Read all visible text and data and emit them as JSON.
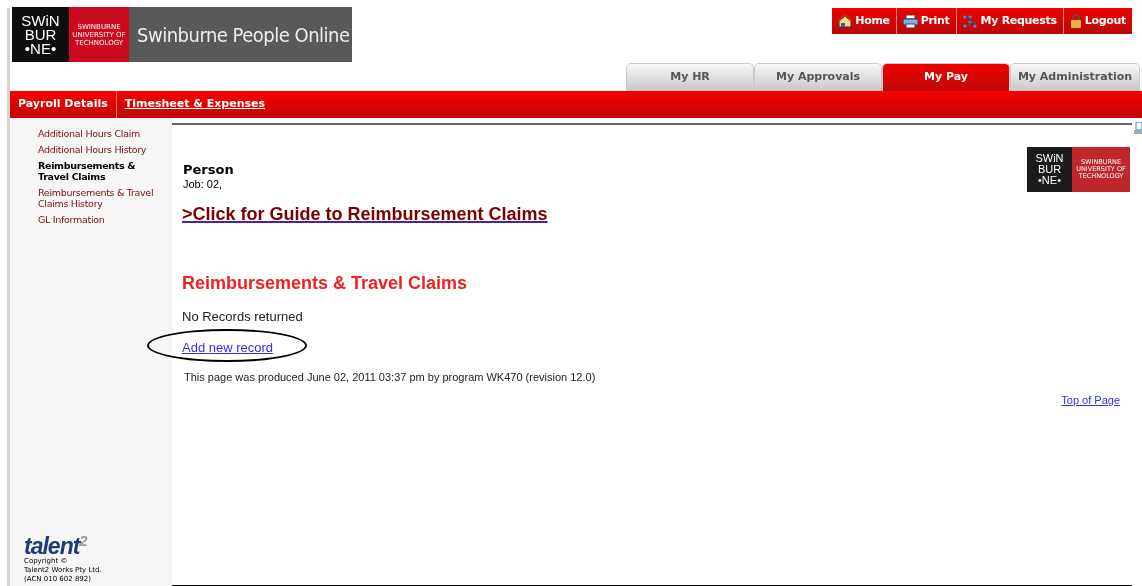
{
  "header": {
    "logo": {
      "lines": [
        "SWiN",
        "BUR",
        "•NE•"
      ],
      "tagline": "SWINBURNE UNIVERSITY OF TECHNOLOGY"
    },
    "title": "Swinburne People Online"
  },
  "top_buttons": [
    {
      "kind": "home",
      "label": "Home"
    },
    {
      "kind": "print",
      "label": "Print"
    },
    {
      "kind": "requests",
      "label": "My Requests"
    },
    {
      "kind": "logout",
      "label": "Logout"
    }
  ],
  "tabs": [
    {
      "label": "My HR",
      "selected": false
    },
    {
      "label": "My Approvals",
      "selected": false
    },
    {
      "label": "My Pay",
      "selected": true
    },
    {
      "label": "My Administration",
      "selected": false
    }
  ],
  "subnav": [
    {
      "label": "Payroll Details",
      "selected": true
    },
    {
      "label": "Timesheet & Expenses",
      "selected": false
    }
  ],
  "sidebar": {
    "items": [
      {
        "label": "Additional Hours Claim",
        "selected": false
      },
      {
        "label": "Additional Hours History",
        "selected": false
      },
      {
        "label": "Reimbursements & Travel Claims",
        "selected": true
      },
      {
        "label": "Reimbursements & Travel Claims History",
        "selected": false
      },
      {
        "label": "GL Information",
        "selected": false
      }
    ],
    "footer": {
      "brand": "talent",
      "brand_sup": "2",
      "copyright": [
        "Copyright ©",
        "Talent2 Works Pty Ltd.",
        "(ACN 010 602 892)"
      ]
    }
  },
  "main": {
    "person": "Person",
    "job": "Job: 02,",
    "guide_link": ">Click for Guide to Reimbursement Claims",
    "logo": {
      "lines": [
        "SWiN",
        "BUR",
        "•NE•"
      ],
      "tagline": "SWINBURNE UNIVERSITY OF TECHNOLOGY"
    },
    "heading": "Reimbursements & Travel Claims",
    "message": "No Records returned",
    "add_link": "Add new record",
    "footer_note": "This page was produced June 02, 2011 03:37 pm by program WK470 (revision 12.0)",
    "top_link": "Top of Page"
  }
}
